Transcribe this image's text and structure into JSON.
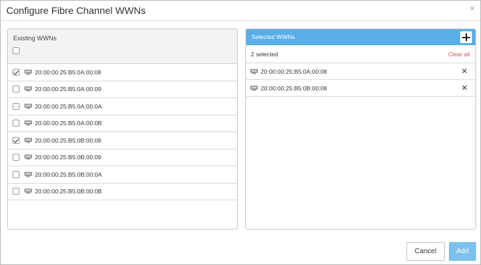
{
  "dialog": {
    "title": "Configure Fibre Channel WWNs",
    "close_symbol": "×"
  },
  "existing": {
    "header_label": "Existing WWNs",
    "select_all_checked": false,
    "rows": [
      {
        "wwn": "20:00:00:25:B5:0A:00:08",
        "checked": true
      },
      {
        "wwn": "20:00:00:25:B5:0A:00:09",
        "checked": false
      },
      {
        "wwn": "20:00:00:25:B5:0A:00:0A",
        "checked": false
      },
      {
        "wwn": "20:00:00:25:B5:0A:00:0B",
        "checked": false
      },
      {
        "wwn": "20:00:00:25:B5:0B:00:08",
        "checked": true
      },
      {
        "wwn": "20:00:00:25:B5:0B:00:09",
        "checked": false
      },
      {
        "wwn": "20:00:00:25:B5:0B:00:0A",
        "checked": false
      },
      {
        "wwn": "20:00:00:25:B5:0B:00:0B",
        "checked": false
      }
    ]
  },
  "selected": {
    "header_label": "Selected WWNs",
    "count_label": "2 selected",
    "clear_all_label": "Clear all",
    "remove_symbol": "✕",
    "rows": [
      {
        "wwn": "20:00:00:25:B5:0A:00:08"
      },
      {
        "wwn": "20:00:00:25:B5:0B:00:08"
      }
    ]
  },
  "footer": {
    "cancel_label": "Cancel",
    "add_label": "Add"
  },
  "colors": {
    "accent": "#5aaee8",
    "add_button": "#7cc1ee",
    "clear_all": "#d9534f"
  },
  "icons": {
    "port": "fc-port-icon",
    "add": "plus-icon",
    "close": "close-icon",
    "remove": "remove-x-icon"
  }
}
